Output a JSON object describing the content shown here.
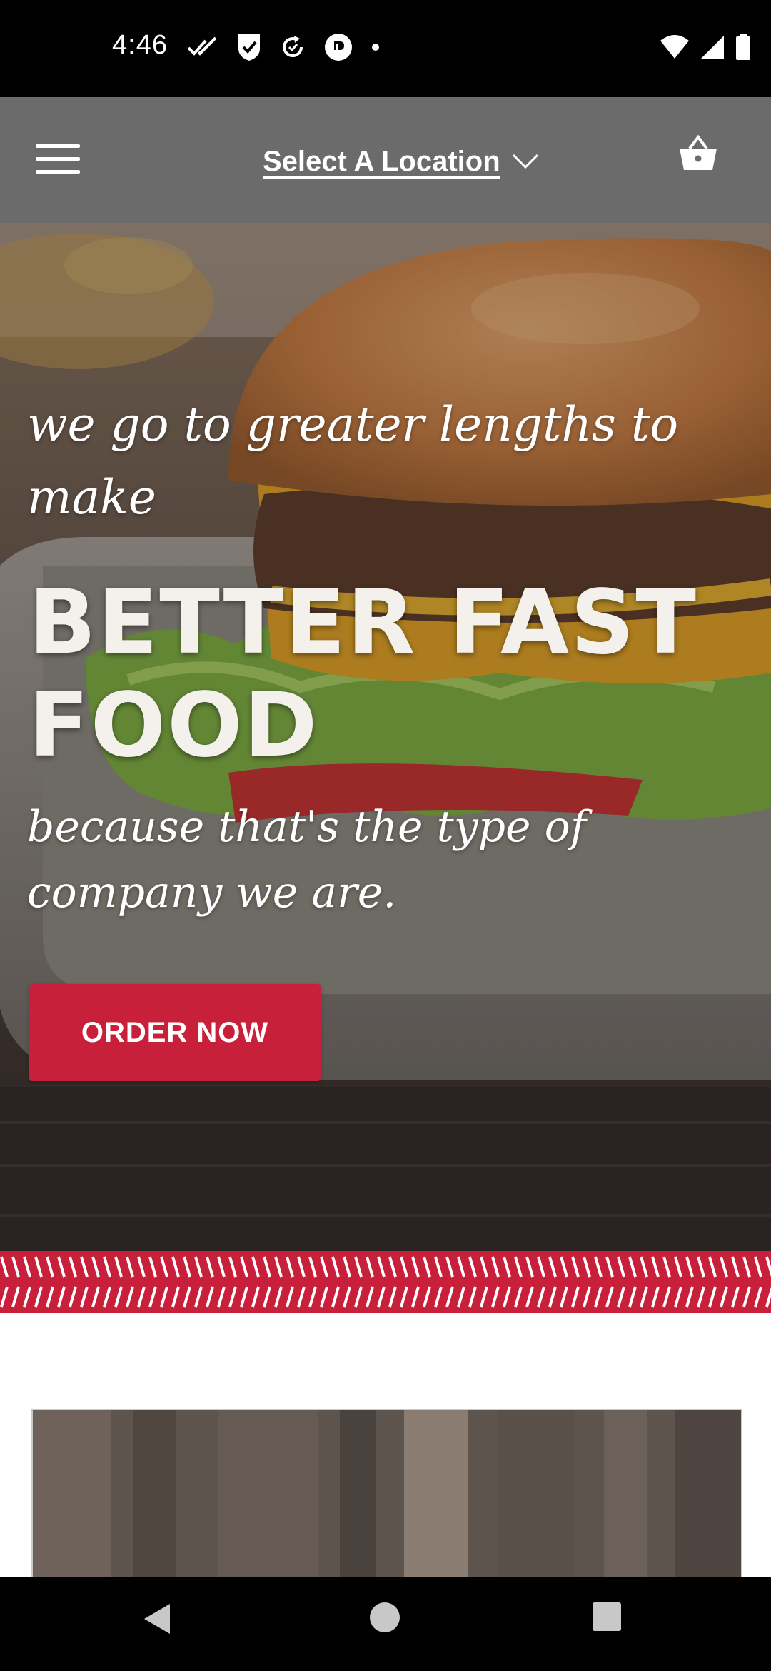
{
  "status_bar": {
    "time": "4:46",
    "left_icons": [
      "double-check-icon",
      "shield-check-icon",
      "sync-icon",
      "app-p-icon",
      "dot-icon"
    ],
    "right_icons": [
      "wifi-icon",
      "signal-icon",
      "battery-icon"
    ]
  },
  "header": {
    "menu_icon": "hamburger-menu-icon",
    "location_label": "Select A Location",
    "cart_icon": "basket-icon"
  },
  "hero": {
    "script_top": "we go to greater lengths to make",
    "headline": "BETTER FAST FOOD",
    "script_bottom": "because that's the type of company we are.",
    "cta_label": "ORDER NOW"
  },
  "colors": {
    "header_bg": "#6b6b6b",
    "accent_red": "#c8203b",
    "status_bar_bg": "#000000"
  },
  "nav_bar": {
    "buttons": [
      "back-icon",
      "home-icon",
      "recents-icon"
    ]
  }
}
